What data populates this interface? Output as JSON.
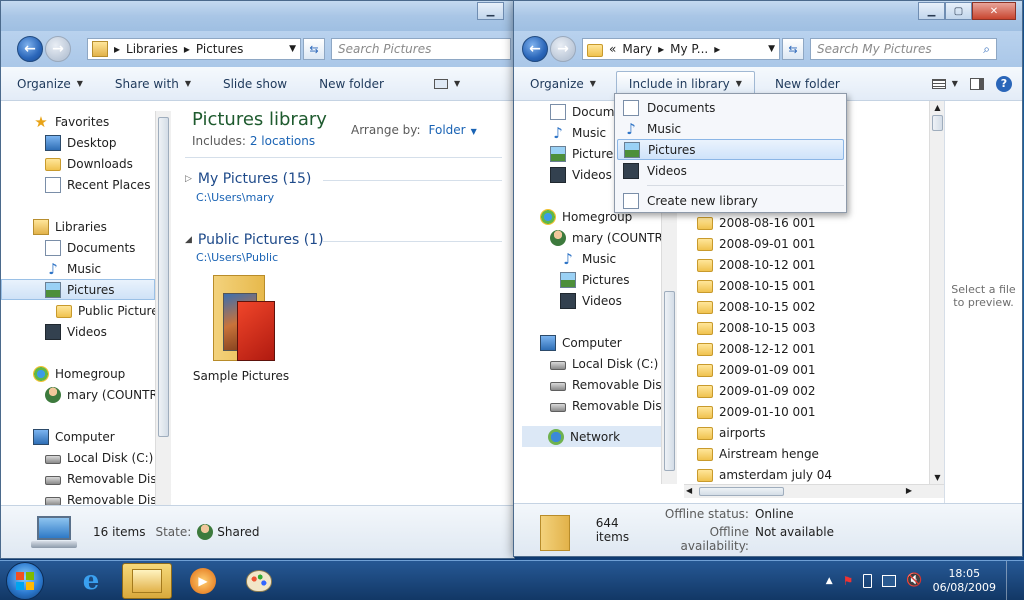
{
  "back_window": {
    "address": [
      "Libraries",
      "Pictures"
    ],
    "search_placeholder": "Search Pictures",
    "toolbar": [
      "Organize",
      "Share with",
      "Slide show",
      "New folder"
    ],
    "nav": {
      "favorites_label": "Favorites",
      "favorites": [
        "Desktop",
        "Downloads",
        "Recent Places"
      ],
      "libraries_label": "Libraries",
      "libraries": [
        "Documents",
        "Music",
        "Pictures",
        "Public Pictures",
        "Videos"
      ],
      "homegroup_label": "Homegroup",
      "homegroup_user": "mary (COUNTRU",
      "computer_label": "Computer",
      "drives": [
        "Local Disk (C:)",
        "Removable Disk (",
        "Removable Disk ("
      ]
    },
    "content": {
      "title": "Pictures library",
      "includes_label": "Includes:",
      "includes_link": "2 locations",
      "arrange_label": "Arrange by:",
      "arrange_value": "Folder",
      "group1_title": "My Pictures (15)",
      "group1_path": "C:\\Users\\mary",
      "group2_title": "Public Pictures (1)",
      "group2_path": "C:\\Users\\Public",
      "folder_name": "Sample Pictures"
    },
    "status": {
      "items": "16 items",
      "state_label": "State:",
      "state_value": "Shared"
    }
  },
  "front_window": {
    "address": [
      "«",
      "Mary",
      "My P..."
    ],
    "search_placeholder": "Search My Pictures",
    "toolbar": [
      "Organize",
      "Include in library",
      "New folder"
    ],
    "nav": {
      "libraries": [
        "Docume",
        "Music",
        "Pictures",
        "Videos"
      ],
      "homegroup_label": "Homegroup",
      "homegroup_user": "mary (COUNTRU",
      "homegroup_items": [
        "Music",
        "Pictures",
        "Videos"
      ],
      "computer_label": "Computer",
      "drives": [
        "Local Disk (C:)",
        "Removable Disk (",
        "Removable Disk ("
      ],
      "network_label": "Network"
    },
    "files": [
      "2008-08-16 001",
      "2008-09-01 001",
      "2008-10-12 001",
      "2008-10-15 001",
      "2008-10-15 002",
      "2008-10-15 003",
      "2008-12-12 001",
      "2009-01-09 001",
      "2009-01-09 002",
      "2009-01-10 001",
      "airports",
      "Airstream henge",
      "amsterdam july 04"
    ],
    "preview_text": "Select a file to preview.",
    "status": {
      "items": "644 items",
      "offline_status_label": "Offline status:",
      "offline_status_value": "Online",
      "offline_avail_label": "Offline availability:",
      "offline_avail_value": "Not available"
    }
  },
  "dropdown": {
    "items": [
      "Documents",
      "Music",
      "Pictures",
      "Videos"
    ],
    "create": "Create new library",
    "highlighted": "Pictures"
  },
  "taskbar": {
    "time": "18:05",
    "date": "06/08/2009"
  }
}
